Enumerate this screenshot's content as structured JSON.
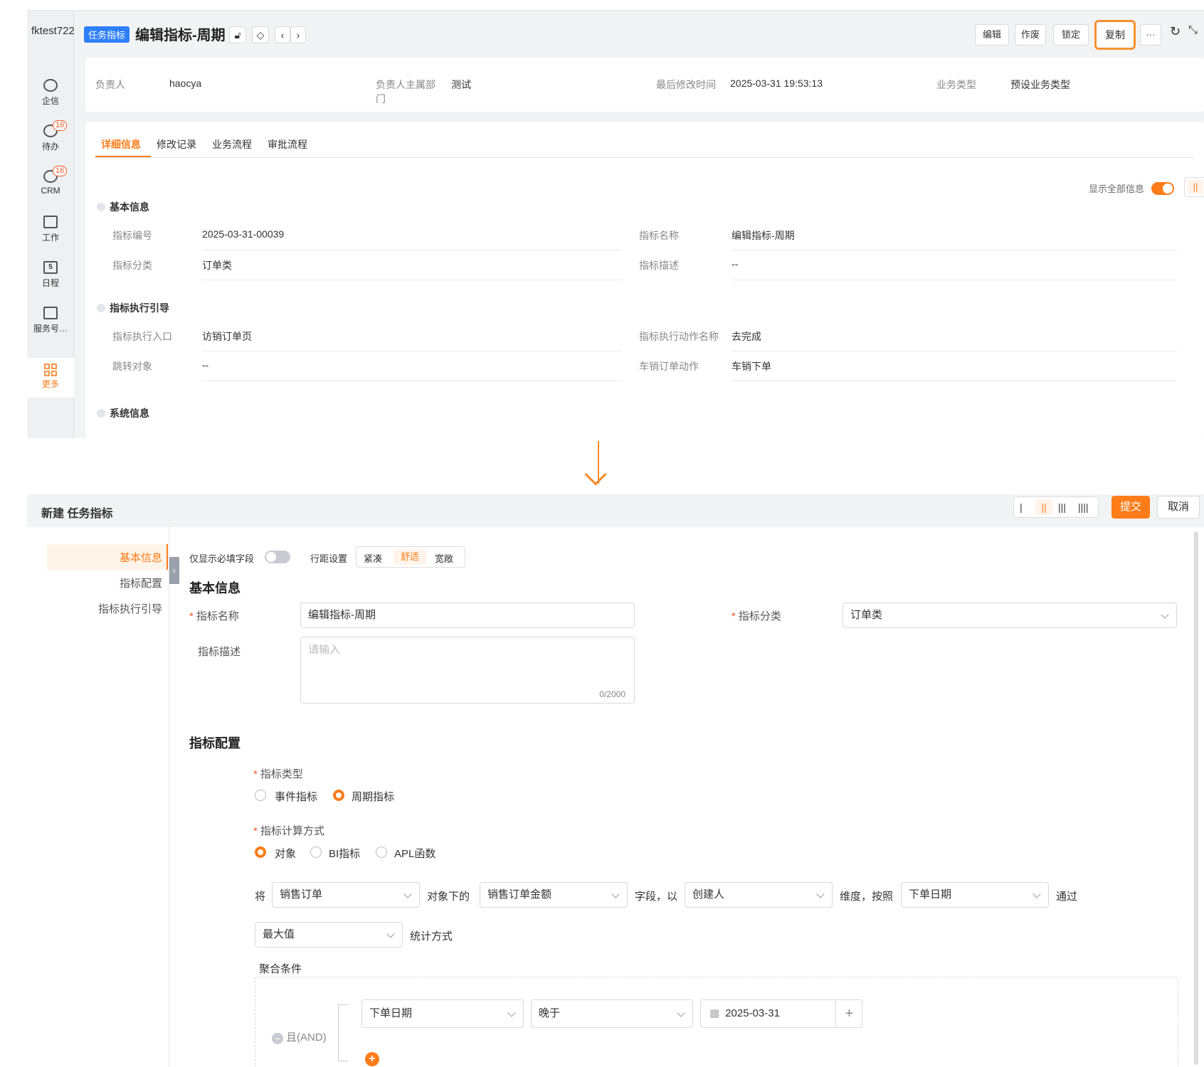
{
  "detail_page": {
    "tenant": "fktest722",
    "tag": "任务指标",
    "title": "编辑指标-周期",
    "actions": {
      "edit": "编辑",
      "void": "作废",
      "lock": "锁定",
      "copy": "复制",
      "more": "···"
    },
    "sidebar": [
      {
        "label": "企信",
        "badge": ""
      },
      {
        "label": "待办",
        "badge": "16"
      },
      {
        "label": "CRM",
        "badge": "16"
      },
      {
        "label": "工作",
        "badge": ""
      },
      {
        "label": "日程",
        "badge": ""
      },
      {
        "label": "服务号…",
        "badge": ""
      },
      {
        "label": "更多",
        "badge": ""
      }
    ],
    "info": {
      "owner_label": "负责人",
      "owner": "haocya",
      "dept_label": "负责人主属部门",
      "dept": "测试",
      "modified_label": "最后修改时间",
      "modified": "2025-03-31 19:53:13",
      "biztype_label": "业务类型",
      "biztype": "预设业务类型"
    },
    "tabs": [
      "详细信息",
      "修改记录",
      "业务流程",
      "审批流程"
    ],
    "show_all": "显示全部信息",
    "sections": {
      "basic": {
        "title": "基本信息",
        "fields": [
          {
            "label": "指标编号",
            "value": "2025-03-31-00039"
          },
          {
            "label": "指标名称",
            "value": "编辑指标-周期"
          },
          {
            "label": "指标分类",
            "value": "订单类"
          },
          {
            "label": "指标描述",
            "value": "--"
          }
        ]
      },
      "guide": {
        "title": "指标执行引导",
        "fields": [
          {
            "label": "指标执行入口",
            "value": "访销订单页"
          },
          {
            "label": "指标执行动作名称",
            "value": "去完成"
          },
          {
            "label": "跳转对象",
            "value": "--"
          },
          {
            "label": "车销订单动作",
            "value": "车销下单"
          }
        ]
      },
      "system": {
        "title": "系统信息"
      }
    }
  },
  "new_form": {
    "title": "新建 任务指标",
    "submit": "提交",
    "cancel": "取消",
    "nav": [
      "基本信息",
      "指标配置",
      "指标执行引导"
    ],
    "required_only": "仅显示必填字段",
    "spacing_label": "行距设置",
    "spacing_options": [
      "紧凑",
      "舒适",
      "宽敞"
    ],
    "basic_title": "基本信息",
    "name_label": "指标名称",
    "name_value": "编辑指标-周期",
    "category_label": "指标分类",
    "category_value": "订单类",
    "desc_label": "指标描述",
    "desc_placeholder": "请输入",
    "desc_count": "0/2000",
    "config_title": "指标配置",
    "type_label": "指标类型",
    "type_options": [
      "事件指标",
      "周期指标"
    ],
    "calc_label": "指标计算方式",
    "calc_options": [
      "对象",
      "BI指标",
      "APL函数"
    ],
    "rule": {
      "t1": "将",
      "object": "销售订单",
      "t2": "对象下的",
      "field": "销售订单金额",
      "t3": "字段，以",
      "dim": "创建人",
      "t4": "维度，按照",
      "date": "下单日期",
      "t5": "通过",
      "stat": "最大值",
      "t6": "统计方式"
    },
    "agg_label": "聚合条件",
    "agg_and": "且(AND)",
    "cond": {
      "field": "下单日期",
      "op": "晚于",
      "value": "2025-03-31"
    }
  }
}
